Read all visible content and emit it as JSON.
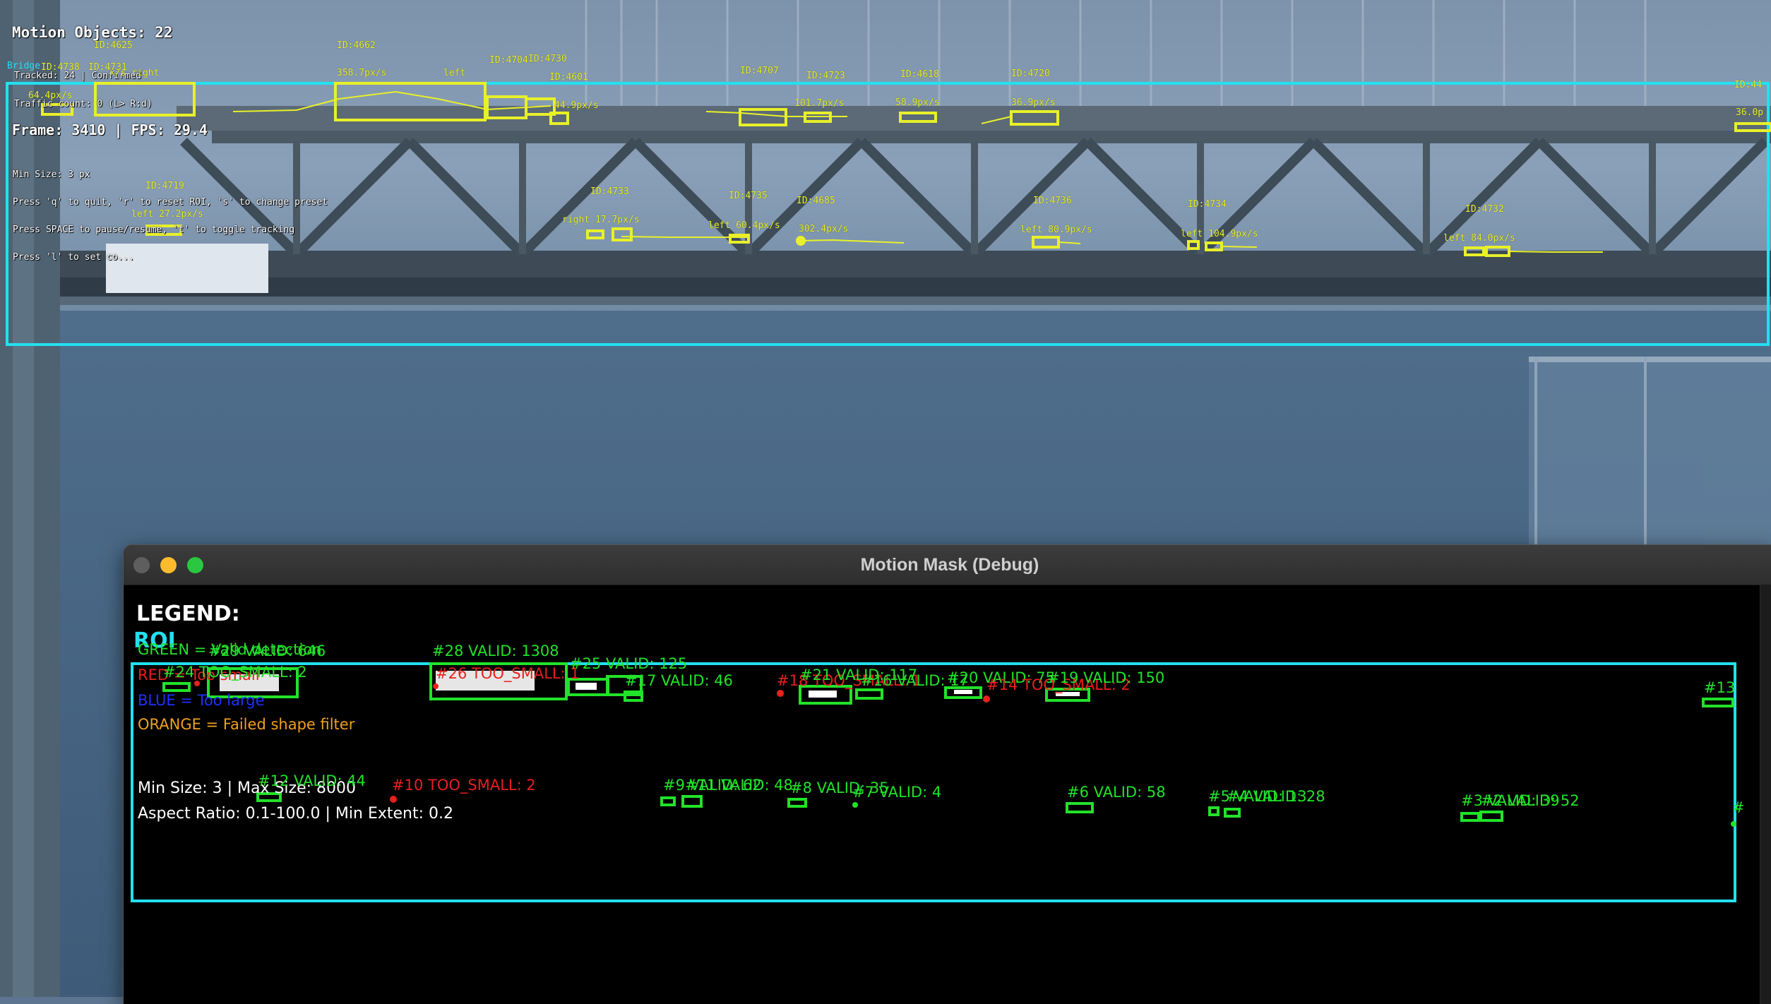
{
  "video": {
    "status": {
      "motion_objects": "Motion Objects: 22",
      "tracked": "Tracked: 24 | Confirmed",
      "traffic": "Traffic count: 0 (L> R:d)",
      "frame": "Frame: 3410 | FPS: 29.4",
      "min_size": "Min Size: 3 px",
      "help_quit": "Press 'q' to quit, 'r' to reset ROI, 's' to change preset",
      "help_space": "Press SPACE to pause/resume, 't' to toggle tracking",
      "help_set": "Press 'l' to set co...",
      "bridge_label": "Bridge"
    },
    "track_labels": [
      {
        "id": "ID:4625"
      },
      {
        "id": "ID:4662"
      },
      {
        "id": "ID:4730"
      },
      {
        "id": "ID:4704"
      },
      {
        "id": "ID:4601"
      },
      {
        "id": "ID:4707"
      },
      {
        "id": "ID:4723"
      },
      {
        "id": "ID:4618"
      },
      {
        "id": "ID:4720"
      },
      {
        "id": "ID:44"
      },
      {
        "id": "ID:4719"
      },
      {
        "id": "ID:4733"
      },
      {
        "id": "ID:4735"
      },
      {
        "id": "ID:4685"
      },
      {
        "id": "ID:4736"
      },
      {
        "id": "ID:4734"
      },
      {
        "id": "ID:4732"
      },
      {
        "id": "ID:4738"
      },
      {
        "id": "ID:4731"
      }
    ],
    "speed_labels": [
      "358.7px/s",
      "left",
      "64.4px/s",
      "44.9px/s",
      "101.7px/s",
      "58.9px/s",
      "36.9px/s",
      "36.0p",
      "left 27.2px/s",
      "right 17.7px/s",
      "left 60.4px/s",
      "302.4px/s",
      "left 80.9px/s",
      "left 104.9px/s",
      "left 84.0px/s",
      "x/s right"
    ]
  },
  "debug": {
    "window_title": "Motion Mask (Debug)",
    "legend": {
      "heading": "LEGEND:",
      "green": "GREEN = Valid detection",
      "red": "RED = Too small",
      "blue": "BLUE = Too large",
      "orange": "ORANGE = Failed shape filter",
      "min_max": "Min Size: 3 | Max Size: 8000",
      "aspect": "Aspect Ratio: 0.1-100.0 | Min Extent: 0.2"
    },
    "roi_label": "ROI",
    "colors": {
      "roi": "#22e0f0",
      "valid": "#22e22a",
      "too_small": "#e8201e",
      "too_large": "#2030ff",
      "shape": "#f0a020",
      "track": "#e8f02a"
    },
    "detections": [
      {
        "text": "#28 VALID: 1308",
        "kind": "valid"
      },
      {
        "text": "#24 TOO_SMALL: 2",
        "kind": "small"
      },
      {
        "text": "#29 VALID: 646",
        "kind": "valid"
      },
      {
        "text": "#26 TOO_SMALL: 1",
        "kind": "small"
      },
      {
        "text": "#25 VALID: 125",
        "kind": "valid"
      },
      {
        "text": "#17 VALID: 46",
        "kind": "valid"
      },
      {
        "text": "#18 TOO_SMALL: 1",
        "kind": "small"
      },
      {
        "text": "#21 VALID: 117",
        "kind": "valid"
      },
      {
        "text": "#16 VALID: 17",
        "kind": "valid"
      },
      {
        "text": "#20 VALID: 75",
        "kind": "valid"
      },
      {
        "text": "#14 TOO_SMALL: 2",
        "kind": "small"
      },
      {
        "text": "#19 VALID: 150",
        "kind": "valid"
      },
      {
        "text": "#13",
        "kind": "valid"
      },
      {
        "text": "#12 VALID: 44",
        "kind": "valid"
      },
      {
        "text": "#10 TOO_SMALL: 2",
        "kind": "small"
      },
      {
        "text": "#9 VALID: 62",
        "kind": "valid"
      },
      {
        "text": "#11 VALID: 48",
        "kind": "valid"
      },
      {
        "text": "#8 VALID: 35",
        "kind": "valid"
      },
      {
        "text": "#7 VALID: 4",
        "kind": "valid"
      },
      {
        "text": "#6 VALID: 58",
        "kind": "valid"
      },
      {
        "text": "#5 VALID: 13",
        "kind": "valid"
      },
      {
        "text": "#4 VALID: 28",
        "kind": "valid"
      },
      {
        "text": "#3 VALID: 39",
        "kind": "valid"
      },
      {
        "text": "#2 VALID: 52",
        "kind": "valid"
      },
      {
        "text": "#",
        "kind": "valid"
      }
    ]
  }
}
